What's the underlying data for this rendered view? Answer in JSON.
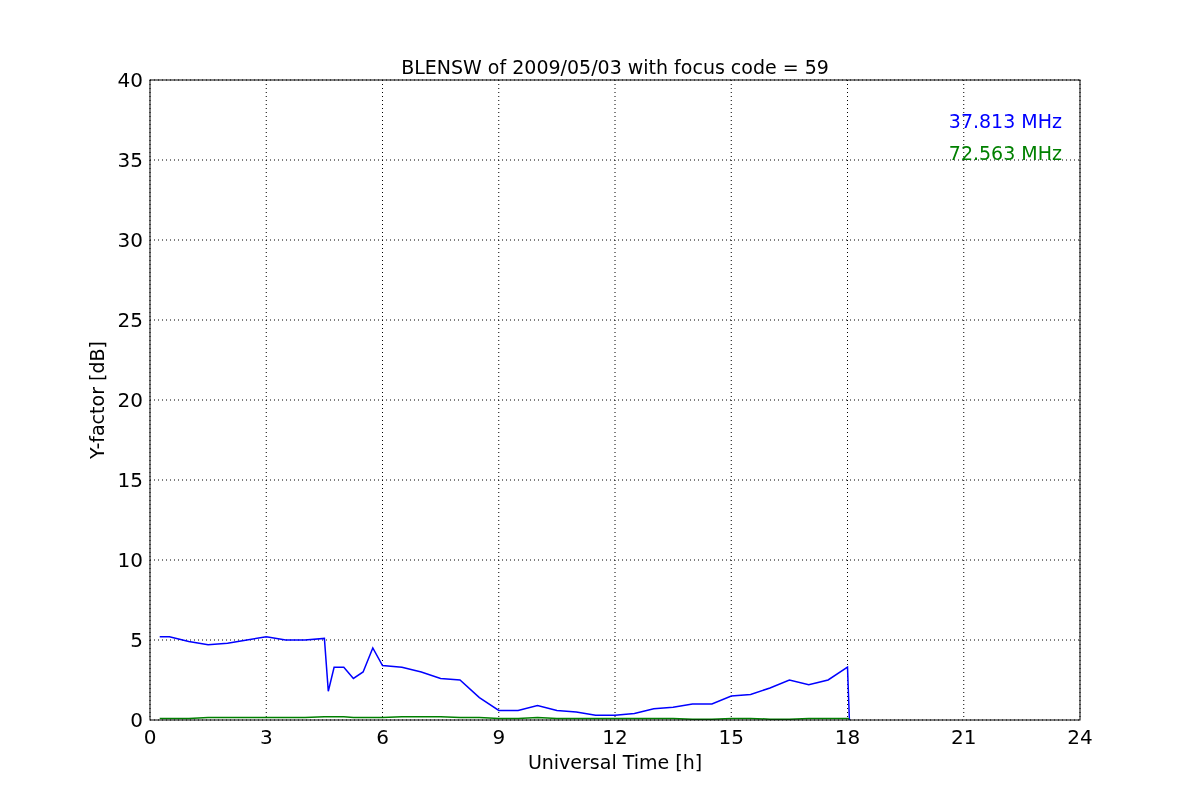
{
  "chart_data": {
    "type": "line",
    "title": "BLENSW of 2009/05/03 with focus code = 59",
    "xlabel": "Universal Time [h]",
    "ylabel": "Y-factor [dB]",
    "x": [
      0.25,
      0.5,
      1.0,
      1.5,
      2.0,
      2.5,
      3.0,
      3.5,
      4.0,
      4.5,
      4.6,
      4.75,
      5.0,
      5.25,
      5.5,
      5.75,
      6.0,
      6.5,
      7.0,
      7.5,
      8.0,
      8.5,
      9.0,
      9.5,
      10.0,
      10.5,
      11.0,
      11.5,
      12.0,
      12.5,
      13.0,
      13.5,
      14.0,
      14.5,
      15.0,
      15.5,
      16.0,
      16.5,
      17.0,
      17.5,
      18.0,
      18.05
    ],
    "series": [
      {
        "name": "37.813 MHz",
        "color": "#0000ff",
        "values": [
          5.2,
          5.2,
          4.9,
          4.7,
          4.8,
          5.0,
          5.2,
          5.0,
          5.0,
          5.1,
          1.8,
          3.3,
          3.3,
          2.6,
          3.0,
          4.5,
          3.4,
          3.3,
          3.0,
          2.6,
          2.5,
          1.4,
          0.6,
          0.6,
          0.9,
          0.6,
          0.5,
          0.3,
          0.3,
          0.4,
          0.7,
          0.8,
          1.0,
          1.0,
          1.5,
          1.6,
          2.0,
          2.5,
          2.2,
          2.5,
          3.3,
          0.0
        ]
      },
      {
        "name": "72.563 MHz",
        "color": "#008000",
        "values": [
          0.1,
          0.1,
          0.1,
          0.15,
          0.15,
          0.15,
          0.15,
          0.15,
          0.15,
          0.2,
          0.2,
          0.2,
          0.2,
          0.15,
          0.15,
          0.15,
          0.15,
          0.2,
          0.2,
          0.2,
          0.15,
          0.15,
          0.1,
          0.1,
          0.15,
          0.1,
          0.1,
          0.1,
          0.1,
          0.1,
          0.1,
          0.1,
          0.05,
          0.05,
          0.1,
          0.1,
          0.05,
          0.05,
          0.1,
          0.1,
          0.1,
          0.05
        ]
      }
    ],
    "grid": true,
    "xlim": [
      0,
      24
    ],
    "ylim": [
      0,
      40
    ],
    "xticks": [
      0,
      3,
      6,
      9,
      12,
      15,
      18,
      21,
      24
    ],
    "yticks": [
      0,
      5,
      10,
      15,
      20,
      25,
      30,
      35,
      40
    ]
  }
}
